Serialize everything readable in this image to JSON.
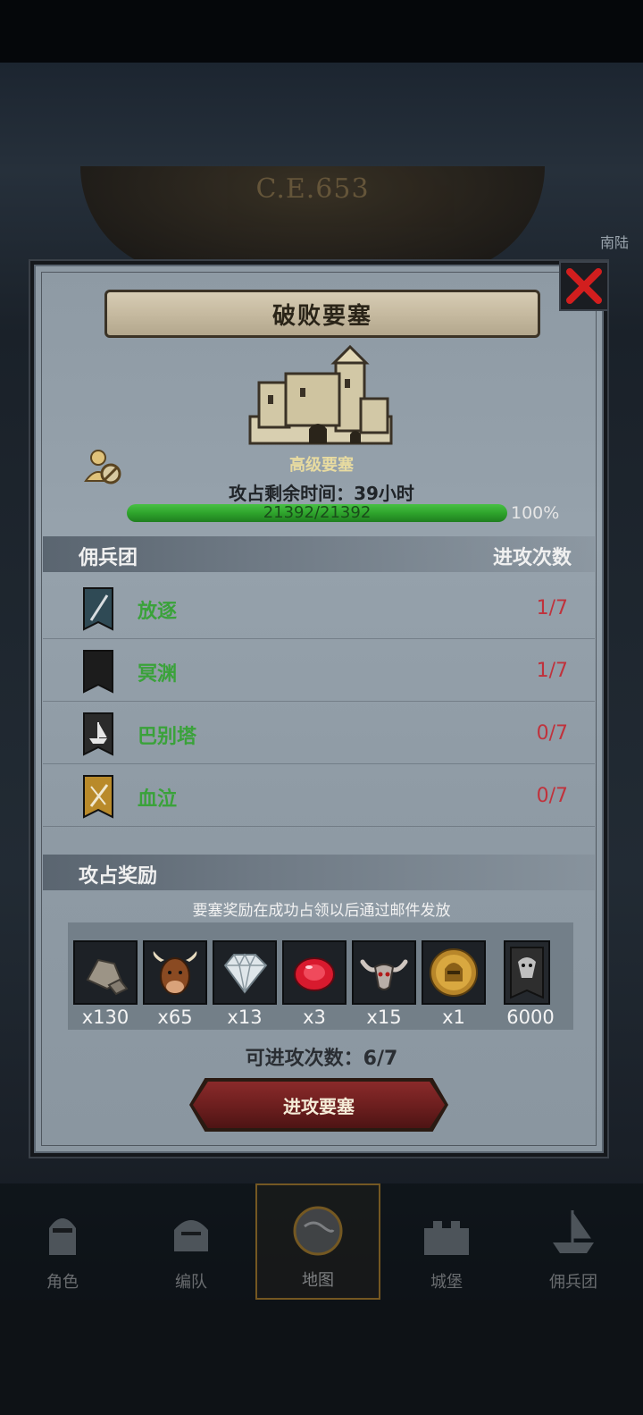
{
  "background": {
    "era": "C.E.653",
    "side_label": "南陆"
  },
  "modal": {
    "title": "破败要塞",
    "fort_level": "高级要塞",
    "time_left": "攻占剩余时间：39小时",
    "hp_text": "21392/21392",
    "hp_percent_label": "100%",
    "hp_fraction": 1.0
  },
  "mercenary_section": {
    "header_left": "佣兵团",
    "header_right": "进攻次数",
    "rows": [
      {
        "name": "放逐",
        "count": "1/7",
        "icon": "sword-banner-icon",
        "color": "#2f4a55"
      },
      {
        "name": "冥渊",
        "count": "1/7",
        "icon": "crescent-banner-icon",
        "color": "#1c1c1c"
      },
      {
        "name": "巴别塔",
        "count": "0/7",
        "icon": "ship-banner-icon",
        "color": "#2a2a2a"
      },
      {
        "name": "血泣",
        "count": "0/7",
        "icon": "dagger-banner-icon",
        "color": "#b98a2a"
      }
    ]
  },
  "reward_section": {
    "header": "攻占奖励",
    "note": "要塞奖励在成功占领以后通过邮件发放",
    "items": [
      {
        "qty": "x130",
        "icon": "stone-icon"
      },
      {
        "qty": "x65",
        "icon": "cattle-icon"
      },
      {
        "qty": "x13",
        "icon": "diamond-icon"
      },
      {
        "qty": "x3",
        "icon": "ruby-icon"
      },
      {
        "qty": "x15",
        "icon": "horned-skull-icon"
      },
      {
        "qty": "x1",
        "icon": "golden-helmet-coin-icon"
      },
      {
        "qty": "6000",
        "icon": "demon-banner-icon"
      }
    ]
  },
  "attack": {
    "remaining": "可进攻次数：6/7",
    "button_label": "进攻要塞"
  },
  "nav": {
    "items": [
      {
        "label": "角色"
      },
      {
        "label": "编队"
      },
      {
        "label": "地图"
      },
      {
        "label": "城堡"
      },
      {
        "label": "佣兵团"
      }
    ]
  },
  "colors": {
    "accent_green": "#3aa23a",
    "count_red": "#c0323c",
    "button_red": "#7a2222"
  }
}
